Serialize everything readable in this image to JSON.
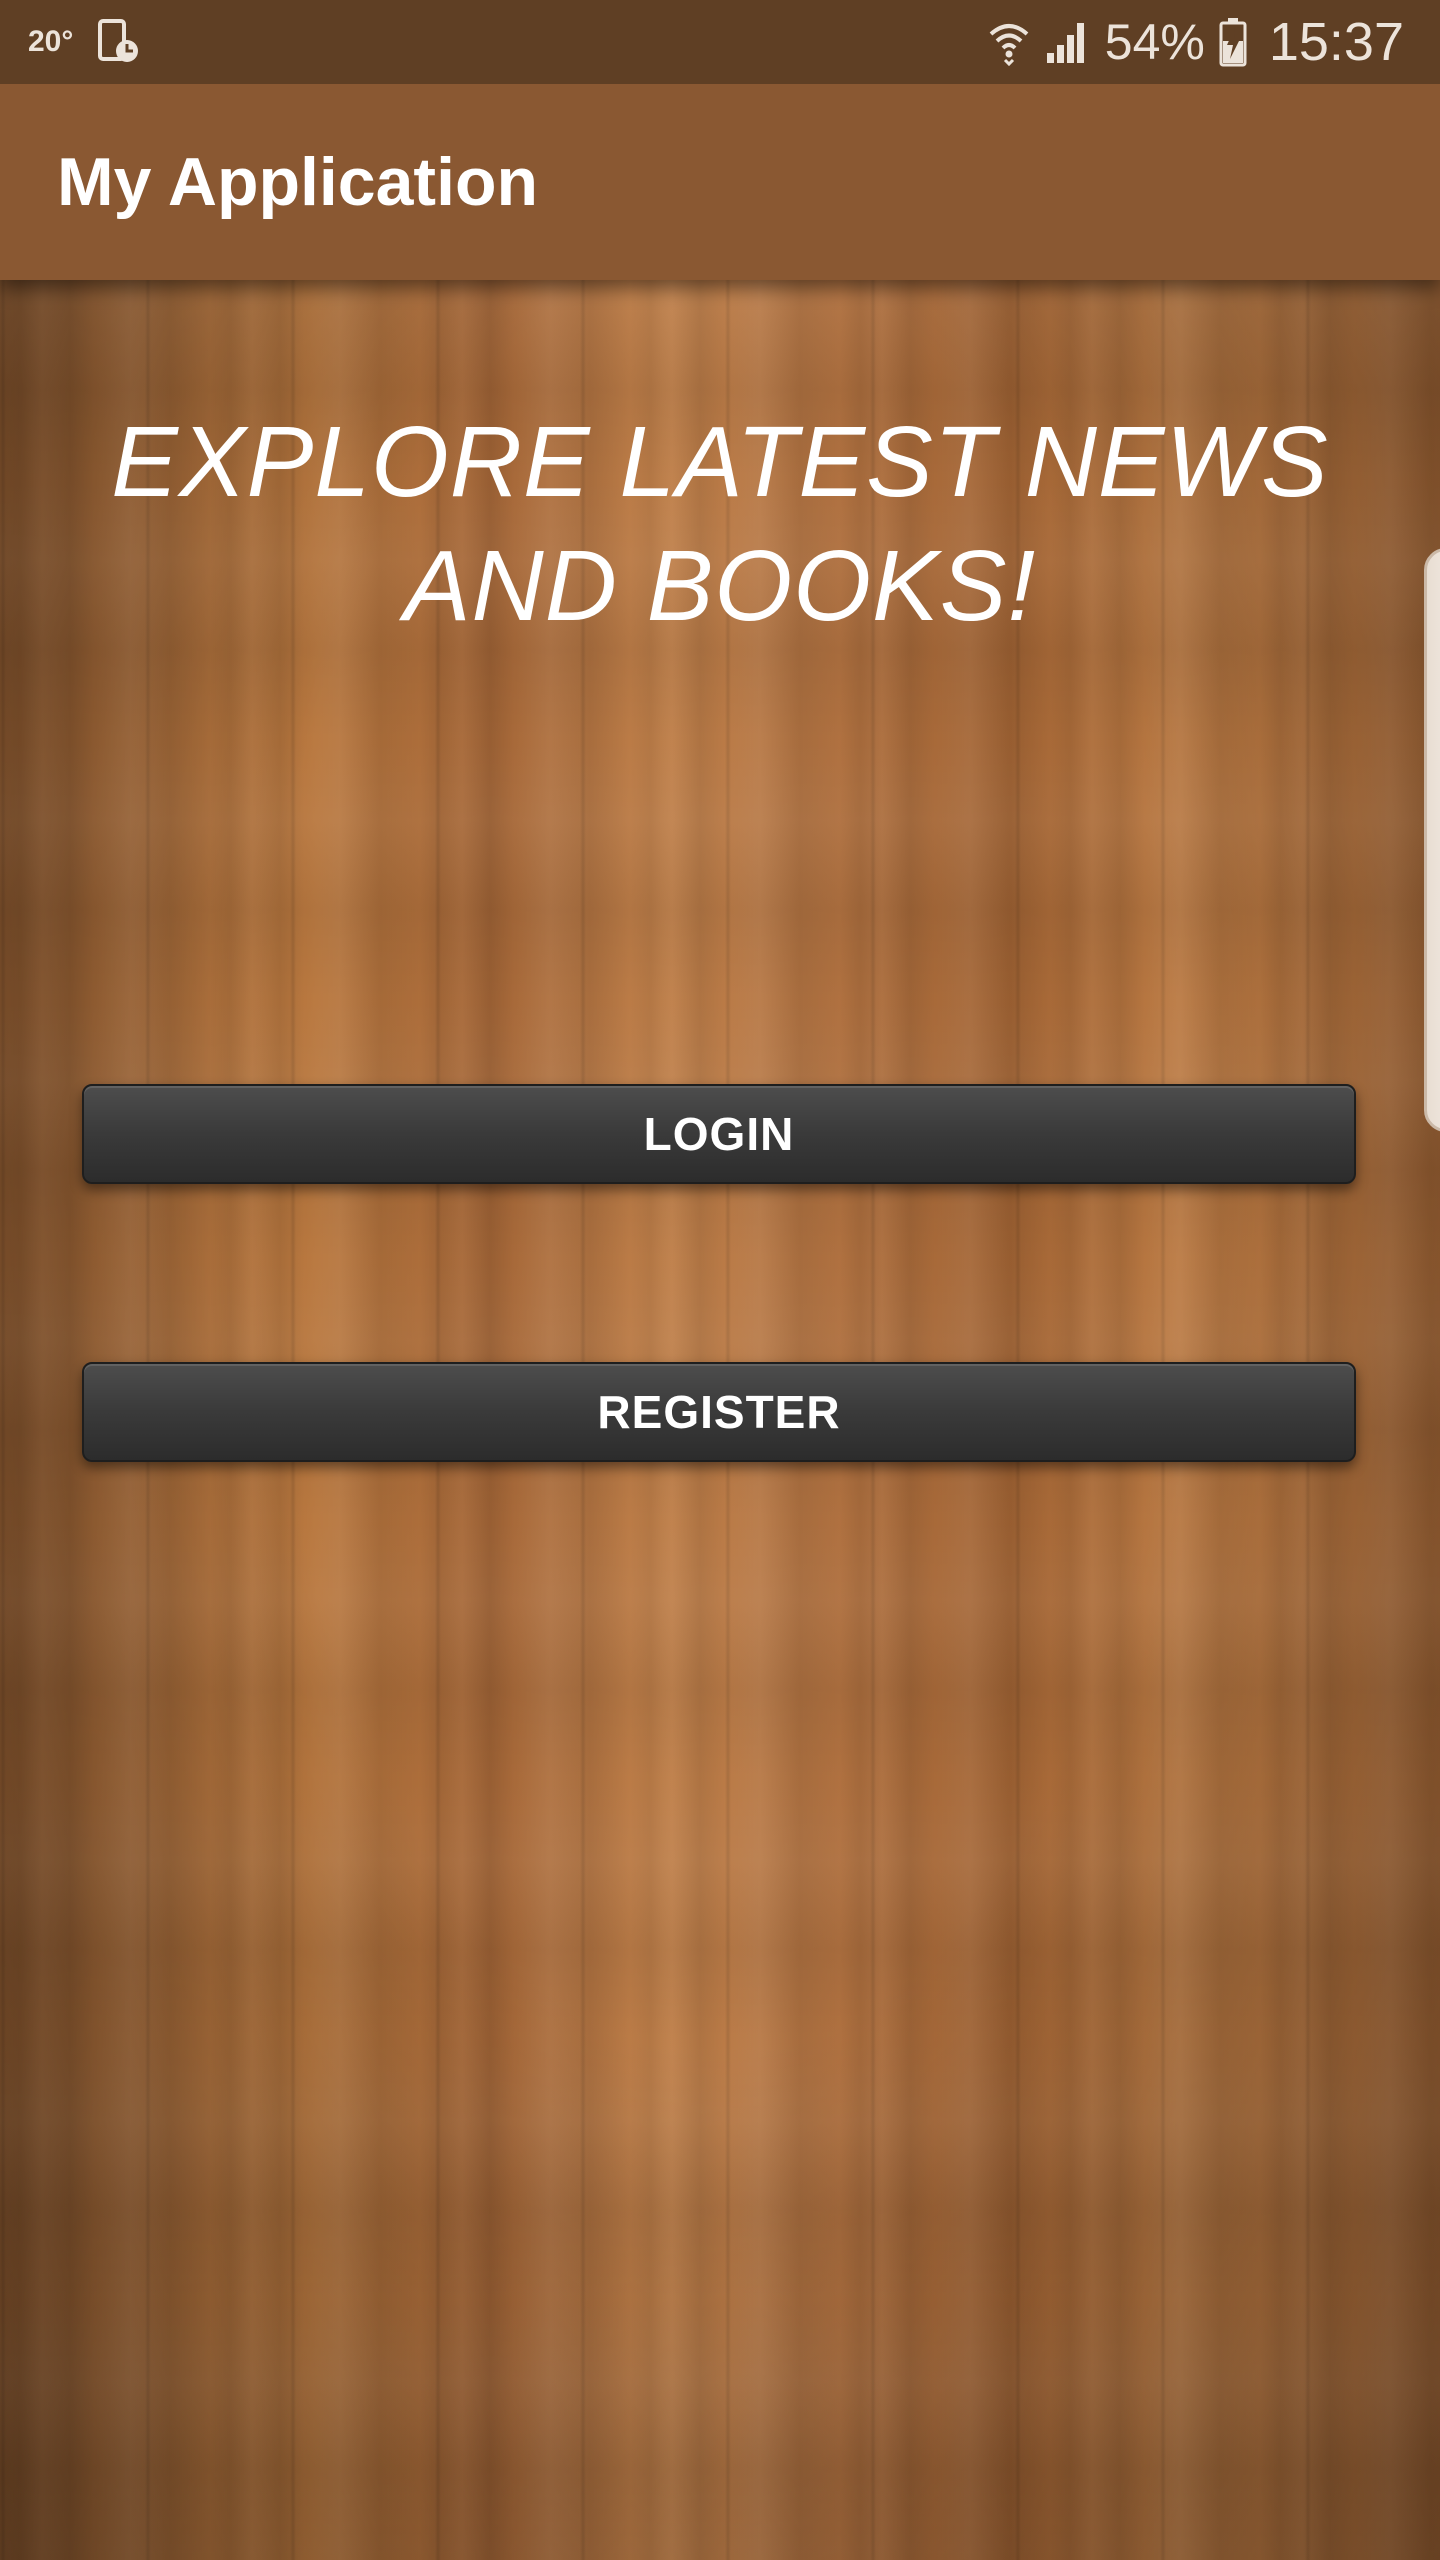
{
  "status_bar": {
    "temperature": "20°",
    "battery_percent": "54%",
    "time": "15:37",
    "icons": [
      "phone-clock-icon",
      "wifi-icon",
      "signal-icon",
      "battery-charging-icon"
    ]
  },
  "app_bar": {
    "title": "My Application"
  },
  "main": {
    "headline": "EXPLORE LATEST NEWS AND BOOKS!",
    "login_label": "LOGIN",
    "register_label": "REGISTER"
  },
  "colors": {
    "status_bar": "#5f3f24",
    "app_bar": "#8a5832",
    "button": "#3a3a3a",
    "text": "#ffffff"
  }
}
